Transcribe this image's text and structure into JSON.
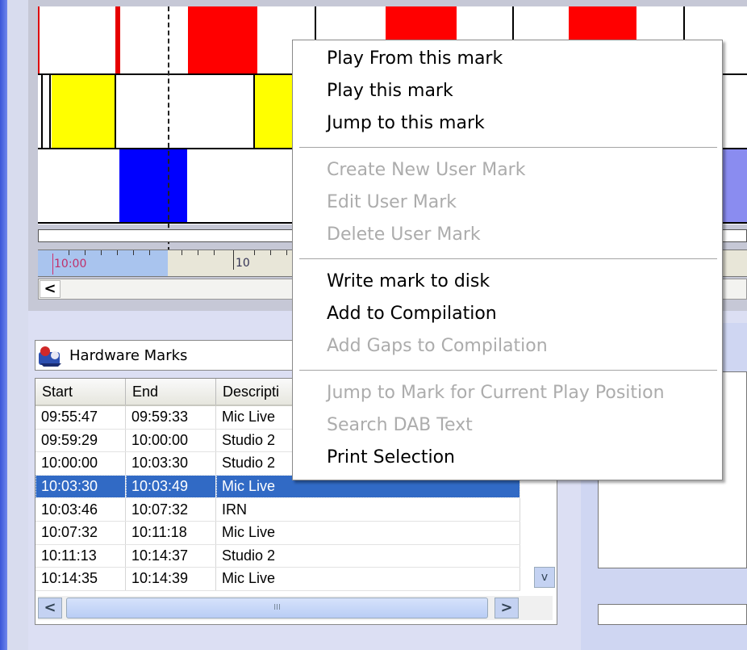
{
  "timeline": {
    "ruler_labels": [
      "10:00",
      "10"
    ],
    "scroll_left_glyph": "<"
  },
  "marks_panel": {
    "title": "Hardware Marks",
    "columns": [
      "Start",
      "End",
      "Descripti"
    ],
    "rows": [
      {
        "start": "09:55:47",
        "end": "09:59:33",
        "desc": "Mic Live",
        "selected": false
      },
      {
        "start": "09:59:29",
        "end": "10:00:00",
        "desc": "Studio 2",
        "selected": false
      },
      {
        "start": "10:00:00",
        "end": "10:03:30",
        "desc": "Studio 2",
        "selected": false
      },
      {
        "start": "10:03:30",
        "end": "10:03:49",
        "desc": "Mic Live",
        "selected": true
      },
      {
        "start": "10:03:46",
        "end": "10:07:32",
        "desc": "IRN",
        "selected": false
      },
      {
        "start": "10:07:32",
        "end": "10:11:18",
        "desc": "Mic Live",
        "selected": false
      },
      {
        "start": "10:11:13",
        "end": "10:14:37",
        "desc": "Studio 2",
        "selected": false
      },
      {
        "start": "10:14:35",
        "end": "10:14:39",
        "desc": "Mic Live",
        "selected": false
      }
    ],
    "scroll_down_glyph": "v",
    "scroll_left_glyph": "<",
    "scroll_right_glyph": ">",
    "scroll_thumb_glyph": "III"
  },
  "context_menu": {
    "items": [
      {
        "label": "Play From this mark",
        "enabled": true
      },
      {
        "label": "Play this mark",
        "enabled": true
      },
      {
        "label": "Jump to this mark",
        "enabled": true
      },
      {
        "label": "Create New User Mark",
        "enabled": false
      },
      {
        "label": "Edit User Mark",
        "enabled": false
      },
      {
        "label": "Delete User Mark",
        "enabled": false
      },
      {
        "label": "Write mark to disk",
        "enabled": true
      },
      {
        "label": "Add to Compilation",
        "enabled": true
      },
      {
        "label": "Add Gaps to Compilation",
        "enabled": false
      },
      {
        "label": "Jump to Mark for Current Play Position",
        "enabled": false
      },
      {
        "label": "Search DAB Text",
        "enabled": false
      },
      {
        "label": "Print Selection",
        "enabled": true
      }
    ]
  },
  "colors": {
    "track_red": "#ff0000",
    "track_yellow": "#ffff00",
    "track_blue": "#0000ff",
    "track_lightblue": "#8a8cf0",
    "selection": "#316ac5",
    "disabled_text": "#acacac"
  }
}
